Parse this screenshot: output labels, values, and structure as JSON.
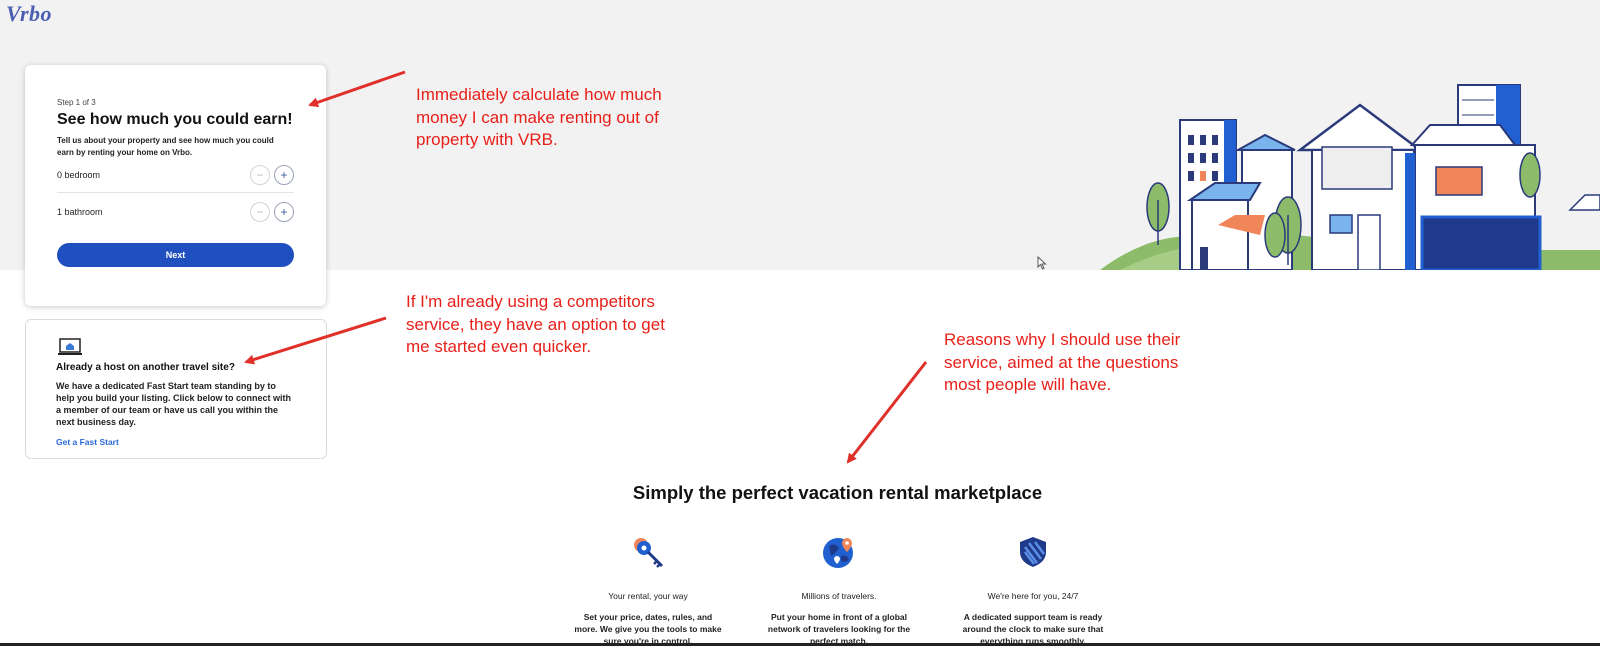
{
  "brand": {
    "logo": "Vrbo"
  },
  "earnings_card": {
    "step": "Step 1 of 3",
    "title": "See how much you could earn!",
    "description": "Tell us about your property and see how much you could earn by renting your home on Vrbo.",
    "bedrooms": {
      "value": "0 bedroom",
      "minus": "−",
      "plus": "+"
    },
    "bathrooms": {
      "value": "1 bathroom",
      "minus": "−",
      "plus": "+"
    },
    "next_label": "Next"
  },
  "fast_start": {
    "icon": "laptop-home-icon",
    "title": "Already a host on another travel site?",
    "description": "We have a dedicated Fast Start team standing by to help you build your listing. Click below to connect with a member of our team or have us call you within the next business day.",
    "link": "Get a Fast Start"
  },
  "annotations": [
    "Immediately calculate how much money I can make renting out of property with VRB.",
    "If I'm already using a competitors service, they have an option to get me started even quicker.",
    "Reasons why I should use their service, aimed at the questions most people will have."
  ],
  "marketplace": {
    "title": "Simply the perfect vacation rental marketplace",
    "features": [
      {
        "icon": "keys-icon",
        "title": "Your rental, your way",
        "description": "Set your price, dates, rules, and more. We give you the tools to make sure you're in control."
      },
      {
        "icon": "globe-icon",
        "title": "Millions of travelers.",
        "description": "Put your home in front of a global network of travelers looking for the perfect match."
      },
      {
        "icon": "shield-icon",
        "title": "We're here for you, 24/7",
        "description": "A dedicated support team is ready around the clock to make sure that everything runs smoothly."
      }
    ]
  },
  "colors": {
    "brand_blue": "#2050c0",
    "annotation_red": "#e8201a",
    "hero_bg": "#f3f2f2"
  }
}
